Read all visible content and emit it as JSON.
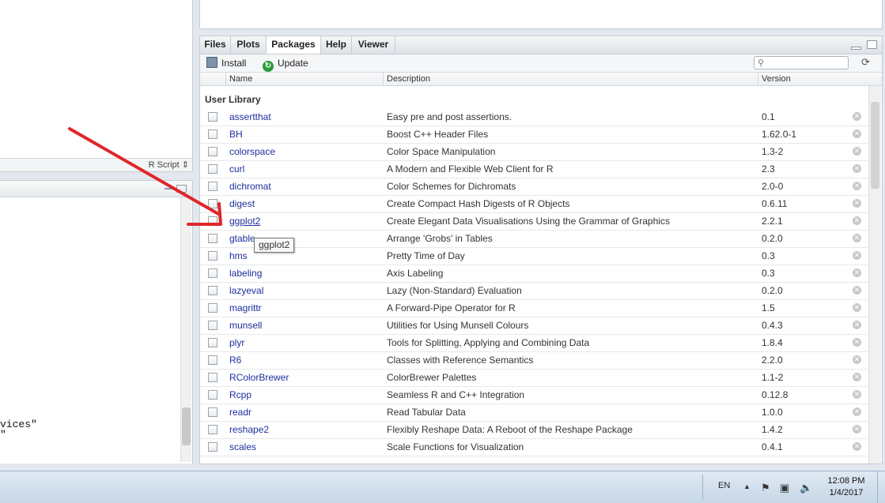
{
  "script_pane": {
    "file_type": "R Script ⇕"
  },
  "console": {
    "lines": [
      "vices\"",
      "\""
    ]
  },
  "tabs": [
    {
      "label": "Files"
    },
    {
      "label": "Plots"
    },
    {
      "label": "Packages"
    },
    {
      "label": "Help"
    },
    {
      "label": "Viewer"
    }
  ],
  "toolbar": {
    "install_label": "Install",
    "update_label": "Update",
    "search_placeholder": ""
  },
  "columns": {
    "name": "Name",
    "description": "Description",
    "version": "Version"
  },
  "library_label": "User Library",
  "packages": [
    {
      "name": "assertthat",
      "description": "Easy pre and post assertions.",
      "version": "0.1"
    },
    {
      "name": "BH",
      "description": "Boost C++ Header Files",
      "version": "1.62.0-1"
    },
    {
      "name": "colorspace",
      "description": "Color Space Manipulation",
      "version": "1.3-2"
    },
    {
      "name": "curl",
      "description": "A Modern and Flexible Web Client for R",
      "version": "2.3"
    },
    {
      "name": "dichromat",
      "description": "Color Schemes for Dichromats",
      "version": "2.0-0"
    },
    {
      "name": "digest",
      "description": "Create Compact Hash Digests of R Objects",
      "version": "0.6.11"
    },
    {
      "name": "ggplot2",
      "description": "Create Elegant Data Visualisations Using the Grammar of Graphics",
      "version": "2.2.1"
    },
    {
      "name": "gtable",
      "description": "Arrange 'Grobs' in Tables",
      "version": "0.2.0"
    },
    {
      "name": "hms",
      "description": "Pretty Time of Day",
      "version": "0.3"
    },
    {
      "name": "labeling",
      "description": "Axis Labeling",
      "version": "0.3"
    },
    {
      "name": "lazyeval",
      "description": "Lazy (Non-Standard) Evaluation",
      "version": "0.2.0"
    },
    {
      "name": "magrittr",
      "description": "A Forward-Pipe Operator for R",
      "version": "1.5"
    },
    {
      "name": "munsell",
      "description": "Utilities for Using Munsell Colours",
      "version": "0.4.3"
    },
    {
      "name": "plyr",
      "description": "Tools for Splitting, Applying and Combining Data",
      "version": "1.8.4"
    },
    {
      "name": "R6",
      "description": "Classes with Reference Semantics",
      "version": "2.2.0"
    },
    {
      "name": "RColorBrewer",
      "description": "ColorBrewer Palettes",
      "version": "1.1-2"
    },
    {
      "name": "Rcpp",
      "description": "Seamless R and C++ Integration",
      "version": "0.12.8"
    },
    {
      "name": "readr",
      "description": "Read Tabular Data",
      "version": "1.0.0"
    },
    {
      "name": "reshape2",
      "description": "Flexibly Reshape Data: A Reboot of the Reshape Package",
      "version": "1.4.2"
    },
    {
      "name": "scales",
      "description": "Scale Functions for Visualization",
      "version": "0.4.1"
    }
  ],
  "tooltip": "ggplot2",
  "taskbar": {
    "language": "EN",
    "time": "12:08 PM",
    "date": "1/4/2017"
  },
  "colors": {
    "link": "#1d2f9c",
    "arrow": "#e0262a",
    "update_icon": "#2c9b3a"
  },
  "icons": [
    "install-icon",
    "update-icon",
    "search-icon",
    "refresh-icon",
    "remove-icon",
    "flag-icon",
    "network-icon",
    "speaker-icon"
  ]
}
